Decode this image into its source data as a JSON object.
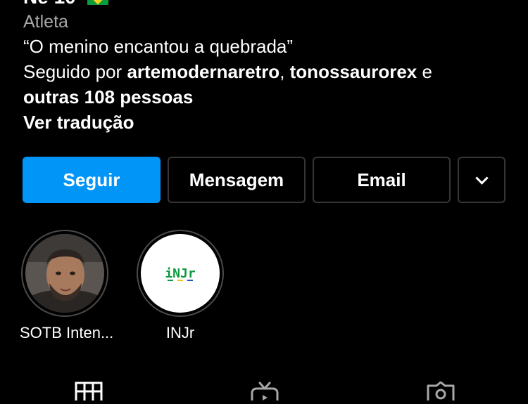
{
  "profile": {
    "name_partial": "Ne 10",
    "category": "Atleta",
    "bio_quote": "“O menino encantou a quebrada”",
    "followed_prefix": "Seguido por ",
    "follower_1": "artemodernaretro",
    "separator": ", ",
    "follower_2": "tonossaurorex",
    "and_word": " e",
    "others": "outras 108 pessoas",
    "translate_link": "Ver tradução"
  },
  "actions": {
    "follow_label": "Seguir",
    "message_label": "Mensagem",
    "email_label": "Email",
    "more_icon": "chevron-down-icon"
  },
  "highlights": [
    {
      "label": "SOTB Inten...",
      "cover": "portrait-photo"
    },
    {
      "label": "INJr",
      "cover": "injr-logo",
      "logo_text": "iNJr"
    }
  ],
  "tabs": [
    {
      "icon": "grid-icon"
    },
    {
      "icon": "reels-icon"
    },
    {
      "icon": "tagged-icon"
    }
  ],
  "colors": {
    "background": "#000000",
    "primary_button": "#0095f6",
    "secondary_text": "#a8a8a8",
    "button_border": "#363636"
  }
}
